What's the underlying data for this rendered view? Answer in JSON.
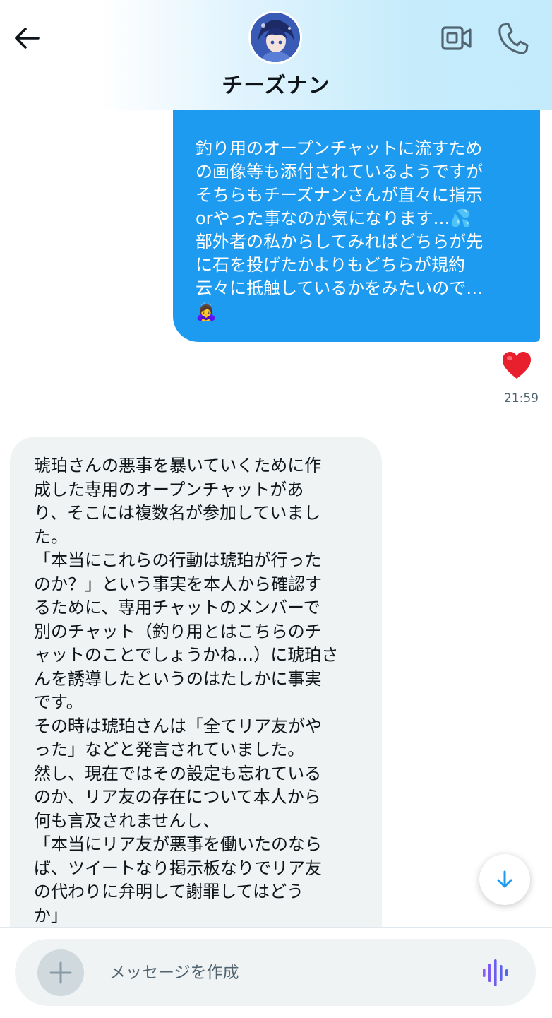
{
  "header": {
    "title": "チーズナン",
    "back_icon": "arrow-left-icon",
    "video_icon": "video-camera-icon",
    "phone_icon": "phone-icon"
  },
  "colors": {
    "accent": "#1d9bf0",
    "incoming_bubble": "#eff3f4",
    "voice_icon": "#8b5cf6",
    "heart": "#e0245e"
  },
  "messages": [
    {
      "direction": "outgoing",
      "lines": [
        "釣り用のオープンチャットに流すため",
        "の画像等も添付されているようですが",
        "そちらもチーズナンさんが直々に指示",
        "orやった事なのか気になります…💦",
        "部外者の私からしてみればどちらが先",
        "に石を投げたかよりもどちらが規約",
        "云々に抵触しているかをみたいので…",
        "🙇‍♀️"
      ],
      "reaction": "❤️",
      "time": "21:59"
    },
    {
      "direction": "incoming",
      "lines": [
        "琥珀さんの悪事を暴いていくために作",
        "成した専用のオープンチャットがあ",
        "り、そこには複数名が参加していまし",
        "た。",
        "「本当にこれらの行動は琥珀が行った",
        "のか？」という事実を本人から確認す",
        "るために、専用チャットのメンバーで",
        "別のチャット（釣り用とはこちらのチ",
        "ャットのことでしょうかね…）に琥珀さ",
        "んを誘導したというのはたしかに事実",
        "です。",
        "その時は琥珀さんは「全てリア友がや",
        "った」などと発言されていました。",
        "然し、現在ではその設定も忘れている",
        "のか、リア友の存在について本人から",
        "何も言及されませんし、",
        "「本当にリア友が悪事を働いたのなら",
        "ば、ツイートなり掲示板なりでリア友",
        "の代わりに弁明して謝罪してはどう",
        "か」"
      ]
    }
  ],
  "composer": {
    "placeholder": "メッセージを作成",
    "add_icon": "plus-icon",
    "voice_icon": "voice-waveform-icon"
  },
  "scroll_down_icon": "arrow-down-icon"
}
